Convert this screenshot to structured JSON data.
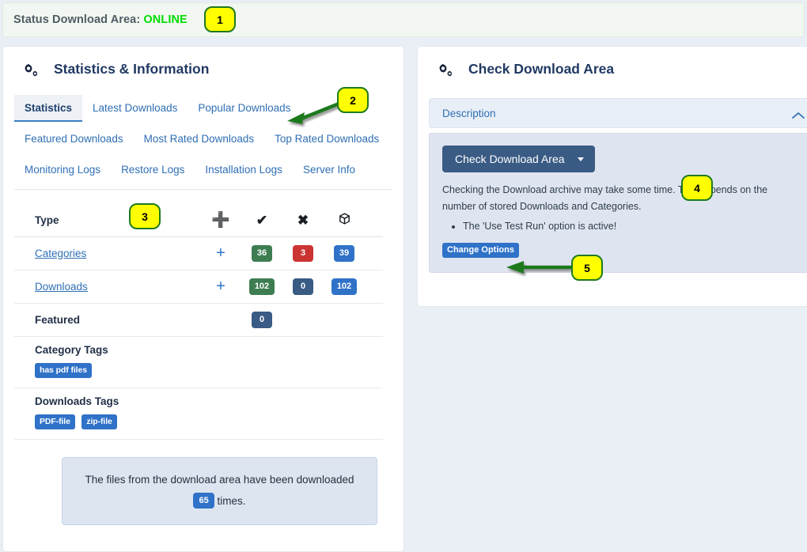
{
  "status_bar": {
    "label": "Status Download Area:",
    "value": "ONLINE",
    "value_color": "#00dd00"
  },
  "left_panel": {
    "title": "Statistics & Information",
    "icon": "cogs-icon",
    "tabs": [
      {
        "label": "Statistics",
        "active": true
      },
      {
        "label": "Latest Downloads",
        "active": false
      },
      {
        "label": "Popular Downloads",
        "active": false
      },
      {
        "label": "Featured Downloads",
        "active": false
      },
      {
        "label": "Most Rated Downloads",
        "active": false
      },
      {
        "label": "Top Rated Downloads",
        "active": false
      },
      {
        "label": "Monitoring Logs",
        "active": false
      },
      {
        "label": "Restore Logs",
        "active": false
      },
      {
        "label": "Installation Logs",
        "active": false
      },
      {
        "label": "Server Info",
        "active": false
      }
    ],
    "table": {
      "headers": {
        "type": "Type",
        "col_plus": "plus-icon",
        "col_check": "check-icon",
        "col_x": "x-icon",
        "col_box": "box-icon"
      },
      "rows": [
        {
          "label": "Categories",
          "is_link": true,
          "plus": "+",
          "published": "36",
          "unpublished": "3",
          "total": "39",
          "published_color": "#3e7d52",
          "unpublished_color": "#cc3333",
          "total_color": "#2f72c8"
        },
        {
          "label": "Downloads",
          "is_link": true,
          "plus": "+",
          "published": "102",
          "unpublished": "0",
          "total": "102",
          "published_color": "#3e7d52",
          "unpublished_color": "#3a5b84",
          "total_color": "#2f72c8"
        }
      ],
      "featured": {
        "label": "Featured",
        "value": "0",
        "color": "#3a5b84"
      }
    },
    "category_tags": {
      "title": "Category Tags",
      "tags": [
        "has pdf files"
      ]
    },
    "downloads_tags": {
      "title": "Downloads Tags",
      "tags": [
        "PDF-file",
        "zip-file"
      ]
    },
    "info_box": {
      "text_before": "The files from the download area have been downloaded",
      "count": "65",
      "text_after": "times."
    }
  },
  "right_panel": {
    "title": "Check Download Area",
    "icon": "cogs-icon",
    "accordion": {
      "label": "Description",
      "state_icon": "chevron-up-icon"
    },
    "action_button": {
      "label": "Check Download Area",
      "caret": "caret-down-icon"
    },
    "description": "Checking the Download archive may take some time. This depends on the number of stored Downloads and Categories.",
    "bullets": [
      "The 'Use Test Run' option is active!"
    ],
    "change_options_button": "Change Options"
  },
  "annotations": [
    {
      "id": "1",
      "number": "1"
    },
    {
      "id": "2",
      "number": "2"
    },
    {
      "id": "3",
      "number": "3"
    },
    {
      "id": "4",
      "number": "4"
    },
    {
      "id": "5",
      "number": "5"
    }
  ]
}
